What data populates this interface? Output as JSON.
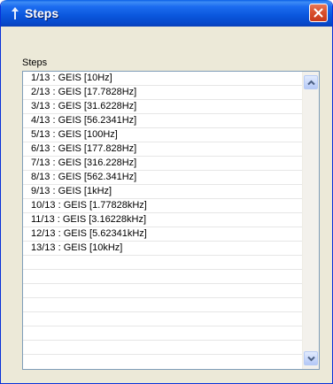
{
  "window": {
    "title": "Steps"
  },
  "steps_group": {
    "label": "Steps",
    "items": [
      "1/13 : GEIS [10Hz]",
      "2/13 : GEIS [17.7828Hz]",
      "3/13 : GEIS [31.6228Hz]",
      "4/13 : GEIS [56.2341Hz]",
      "5/13 : GEIS [100Hz]",
      "6/13 : GEIS [177.828Hz]",
      "7/13 : GEIS [316.228Hz]",
      "8/13 : GEIS [562.341Hz]",
      "9/13 : GEIS [1kHz]",
      "10/13 : GEIS [1.77828kHz]",
      "11/13 : GEIS [3.16228kHz]",
      "12/13 : GEIS [5.62341kHz]",
      "13/13 : GEIS [10kHz]",
      "",
      "",
      "",
      "",
      "",
      "",
      ""
    ]
  },
  "icons": {
    "title": "arrow-icon",
    "close": "close-icon",
    "scroll_up": "chevron-up-icon",
    "scroll_down": "chevron-down-icon"
  }
}
